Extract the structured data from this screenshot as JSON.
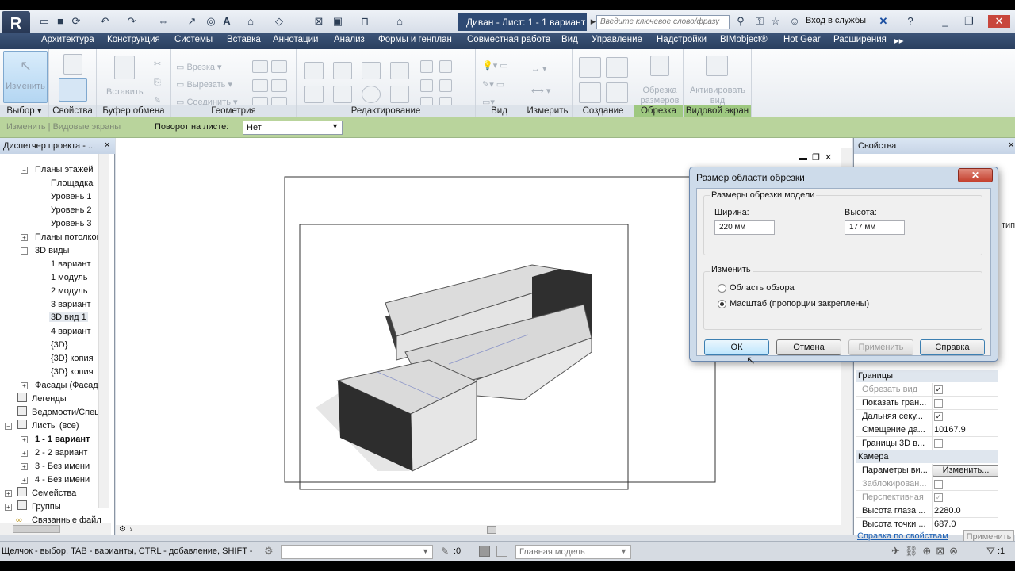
{
  "qat": {
    "title": "Диван - Лист: 1 - 1 вариант",
    "search_placeholder": "Введите ключевое слово/фразу",
    "services": "Вход в службы"
  },
  "tabs": [
    "Архитектура",
    "Конструкция",
    "Системы",
    "Вставка",
    "Аннотации",
    "Анализ",
    "Формы и генплан",
    "Совместная работа",
    "Вид",
    "Управление",
    "Надстройки",
    "BIMobject®",
    "Hot Gear",
    "Расширения"
  ],
  "ribbon": {
    "modify": "Изменить",
    "select": "Выбор",
    "properties": "Свойства",
    "paste": "Вставить",
    "clipboard": "Буфер обмена",
    "cut": "Врезка",
    "cutout": "Вырезать",
    "join": "Соединить",
    "geometry": "Геометрия",
    "edit": "Редактирование",
    "view": "Вид",
    "measure": "Измерить",
    "create": "Создание",
    "crop_btn": "Обрезка размеров",
    "crop": "Обрезка",
    "activate_btn": "Активировать вид",
    "viewport": "Видовой экран"
  },
  "options": {
    "context": "Изменить | Видовые экраны",
    "rotation_label": "Поворот на листе:",
    "rotation_value": "Нет"
  },
  "browser": {
    "title": "Диспетчер проекта - ...",
    "items": [
      "Планы этажей",
      "Площадка",
      "Уровень 1",
      "Уровень 2",
      "Уровень 3",
      "Планы потолков",
      "3D виды",
      "1 вариант",
      "1 модуль",
      "2 модуль",
      "3 вариант",
      "3D вид 1",
      "4 вариант",
      "{3D}",
      "{3D} копия",
      "{3D} копия",
      "Фасады (Фасад",
      "Легенды",
      "Ведомости/Спец",
      "Листы (все)",
      "1 - 1 вариант",
      "2 - 2 вариант",
      "3 - Без имени",
      "4 - Без имени",
      "Семейства",
      "Группы",
      "Связанные файл"
    ]
  },
  "props": {
    "title": "Свойства",
    "section_bounds": "Границы",
    "section_camera": "Камера",
    "rows": [
      {
        "name": "Обрезать вид",
        "val": "✓"
      },
      {
        "name": "Показать гран...",
        "val": ""
      },
      {
        "name": "Дальняя секу...",
        "val": "✓"
      },
      {
        "name": "Смещение да...",
        "val": "10167.9"
      },
      {
        "name": "Границы 3D в...",
        "val": ""
      }
    ],
    "camera_rows": [
      {
        "name": "Параметры ви...",
        "val": "Изменить..."
      },
      {
        "name": "Заблокирован...",
        "val": ""
      },
      {
        "name": "Перспективная",
        "val": "✓"
      },
      {
        "name": "Высота глаза ...",
        "val": "2280.0"
      },
      {
        "name": "Высота точки ...",
        "val": "687.0"
      }
    ],
    "help_link": "Справка по свойствам",
    "apply": "Применить",
    "side_label": "тип"
  },
  "status": {
    "hint": "Щелчок - выбор, TAB - варианты, CTRL - добавление, SHIFT -",
    "counter": ":0",
    "model": "Главная модель",
    "filter": ":1"
  },
  "dialog": {
    "title": "Размер области обрезки",
    "group1": "Размеры обрезки модели",
    "width_label": "Ширина:",
    "width_value": "220 мм",
    "height_label": "Высота:",
    "height_value": "177 мм",
    "group2": "Изменить",
    "opt1": "Область обзора",
    "opt2": "Масштаб (пропорции закреплены)",
    "ok": "ОК",
    "cancel": "Отмена",
    "apply": "Применить",
    "help": "Справка"
  },
  "colors": {
    "accent": "#2e4a74",
    "ribbon_green": "#9ec880",
    "options_bar": "#b9d49c"
  }
}
